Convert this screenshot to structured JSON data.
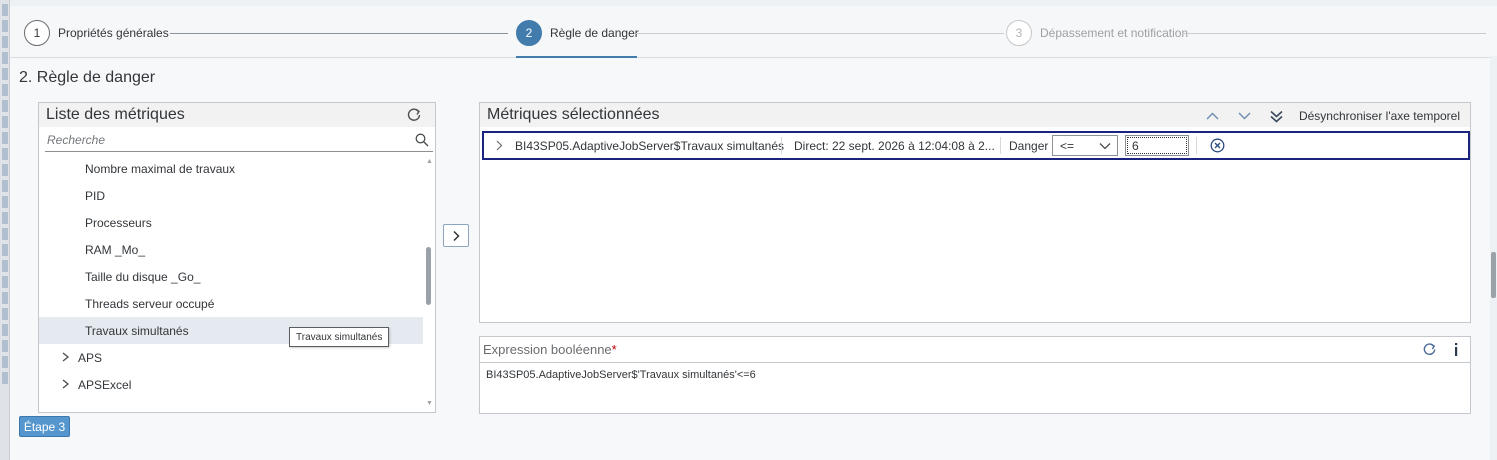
{
  "wizard": {
    "steps": [
      {
        "number": "1",
        "label": "Propriétés générales",
        "state": "completed"
      },
      {
        "number": "2",
        "label": "Règle de danger",
        "state": "active"
      },
      {
        "number": "3",
        "label": "Dépassement et notification",
        "state": "disabled"
      }
    ]
  },
  "page": {
    "title": "2. Règle de danger"
  },
  "metrics_list": {
    "title": "Liste des métriques",
    "search_placeholder": "Recherche",
    "items": [
      {
        "label": "Nombre maximal de travaux",
        "kind": "leaf"
      },
      {
        "label": "PID",
        "kind": "leaf"
      },
      {
        "label": "Processeurs",
        "kind": "leaf"
      },
      {
        "label": "RAM _Mo_",
        "kind": "leaf"
      },
      {
        "label": "Taille du disque _Go_",
        "kind": "leaf"
      },
      {
        "label": "Threads serveur occupé",
        "kind": "leaf"
      },
      {
        "label": "Travaux simultanés",
        "kind": "leaf",
        "selected": true
      },
      {
        "label": "APS",
        "kind": "group"
      },
      {
        "label": "APSExcel",
        "kind": "group"
      }
    ],
    "tooltip": "Travaux simultanés"
  },
  "selected_metrics": {
    "title": "Métriques sélectionnées",
    "desync_label": "Désynchroniser l'axe temporel",
    "rows": [
      {
        "name": "BI43SP05.AdaptiveJobServer$Travaux simultanés",
        "time": "Direct: 22 sept. 2026 à 12:04:08 à 2...",
        "rule": "Danger",
        "operator": "<=",
        "value": "6"
      }
    ]
  },
  "expression": {
    "title": "Expression booléenne",
    "required_mark": "*",
    "value": "BI43SP05.AdaptiveJobServer$'Travaux simultanés'<=6"
  },
  "footer": {
    "next_label": "Étape 3"
  },
  "colors": {
    "accent": "#427cac",
    "row_border": "#1a237e",
    "button": "#5496cd",
    "required": "#bb0000"
  }
}
